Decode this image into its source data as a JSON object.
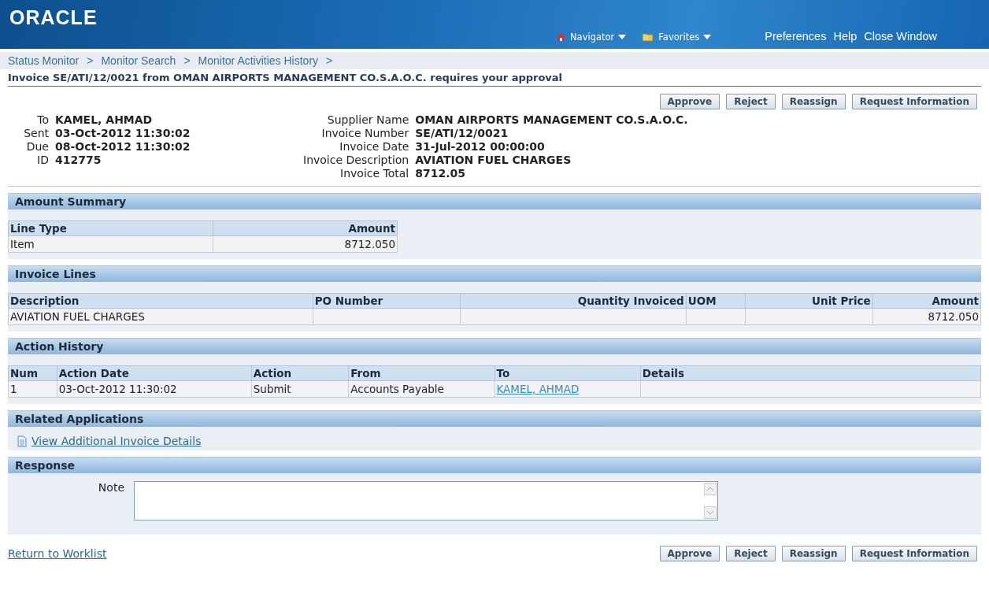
{
  "header": {
    "logo": "ORACLE",
    "menus": [
      {
        "label": "Navigator"
      },
      {
        "label": "Favorites"
      }
    ],
    "links": [
      "Preferences",
      "Help",
      "Close Window"
    ]
  },
  "breadcrumbs": [
    "Status Monitor",
    ">",
    "Monitor Search",
    ">",
    "Monitor Activities History",
    ">"
  ],
  "title": "Invoice SE/ATI/12/0021 from OMAN AIRPORTS MANAGEMENT CO.S.A.O.C. requires your approval",
  "top_buttons": [
    "Approve",
    "Reject",
    "Reassign",
    "Request Information"
  ],
  "details_left": [
    {
      "label": "To",
      "value": "KAMEL, AHMAD"
    },
    {
      "label": "Sent",
      "value": "03-Oct-2012 11:30:02"
    },
    {
      "label": "Due",
      "value": "08-Oct-2012 11:30:02"
    },
    {
      "label": "ID",
      "value": "412775"
    }
  ],
  "details_right": [
    {
      "label": "Supplier Name",
      "value": "OMAN AIRPORTS MANAGEMENT CO.S.A.O.C."
    },
    {
      "label": "Invoice Number",
      "value": "SE/ATI/12/0021"
    },
    {
      "label": "Invoice Date",
      "value": "31-Jul-2012 00:00:00"
    },
    {
      "label": "Invoice Description",
      "value": "AVIATION FUEL CHARGES"
    },
    {
      "label": "Invoice Total",
      "value": "8712.05"
    }
  ],
  "sections": [
    {
      "kind": "table",
      "title": "Amount Summary",
      "columns": [
        {
          "label": "Line Type"
        },
        {
          "label": "Amount"
        }
      ],
      "rows": [
        [
          {
            "text": "Item",
            "kind": "text"
          },
          {
            "text": "8712.050",
            "kind": "text"
          }
        ]
      ]
    },
    {
      "kind": "table",
      "title": "Invoice Lines",
      "columns": [
        {
          "label": "Description"
        },
        {
          "label": "PO Number"
        },
        {
          "label": "Quantity Invoiced"
        },
        {
          "label": "UOM"
        },
        {
          "label": "Unit Price"
        },
        {
          "label": "Amount"
        }
      ],
      "rows": [
        [
          {
            "text": "AVIATION FUEL CHARGES",
            "kind": "text"
          },
          {
            "text": "",
            "kind": "text"
          },
          {
            "text": "",
            "kind": "text"
          },
          {
            "text": "",
            "kind": "text"
          },
          {
            "text": "",
            "kind": "text"
          },
          {
            "text": "8712.050",
            "kind": "text"
          }
        ]
      ]
    },
    {
      "kind": "table",
      "title": "Action History",
      "columns": [
        {
          "label": "Num"
        },
        {
          "label": "Action Date"
        },
        {
          "label": "Action"
        },
        {
          "label": "From"
        },
        {
          "label": "To"
        },
        {
          "label": "Details"
        }
      ],
      "rows": [
        [
          {
            "text": "1",
            "kind": "text"
          },
          {
            "text": "03-Oct-2012 11:30:02",
            "kind": "text"
          },
          {
            "text": "Submit",
            "kind": "text"
          },
          {
            "text": "Accounts Payable",
            "kind": "text"
          },
          {
            "text": "KAMEL, AHMAD",
            "kind": "link"
          },
          {
            "text": "",
            "kind": "text"
          }
        ]
      ]
    },
    {
      "kind": "links",
      "title": "Related Applications",
      "links": [
        "View Additional Invoice Details"
      ]
    },
    {
      "kind": "form",
      "title": "Response",
      "fields": [
        {
          "label": "Note"
        }
      ]
    }
  ],
  "footer": {
    "link": "Return to Worklist",
    "buttons": [
      "Approve",
      "Reject",
      "Reassign",
      "Request Information"
    ]
  }
}
